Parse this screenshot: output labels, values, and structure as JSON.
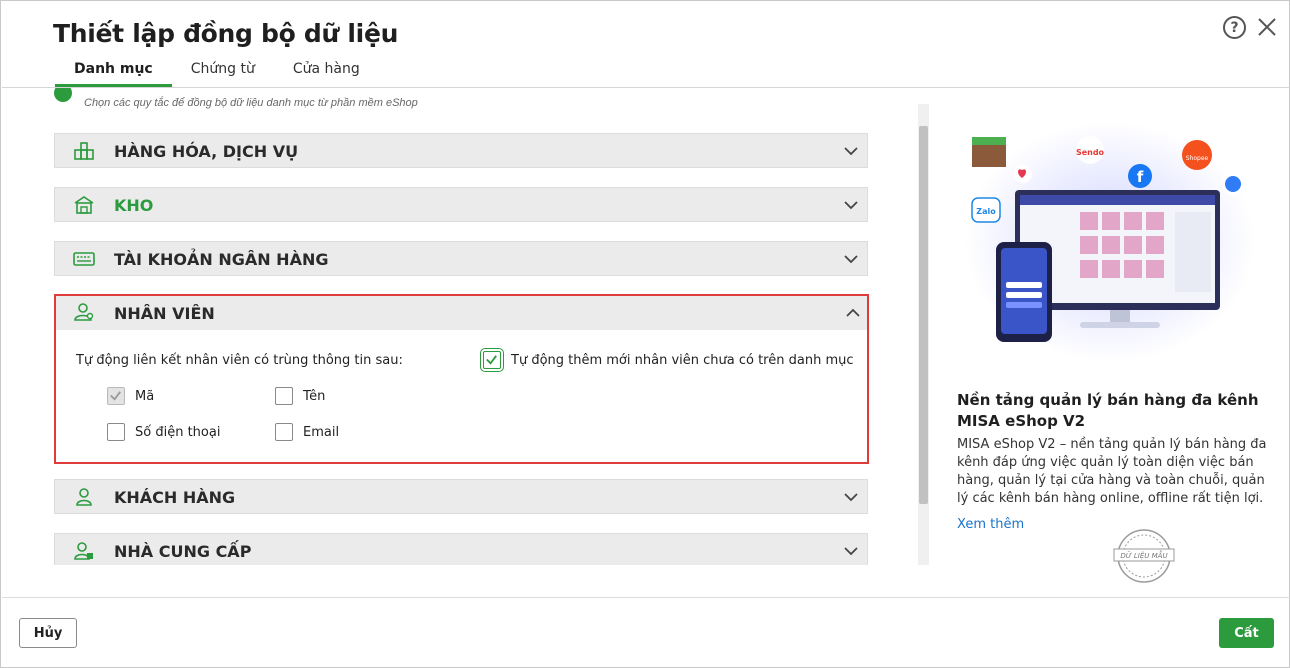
{
  "dialog": {
    "title": "Thiết lập đồng bộ dữ liệu",
    "help_label": "?"
  },
  "tabs": [
    {
      "label": "Danh mục",
      "active": true
    },
    {
      "label": "Chứng từ",
      "active": false
    },
    {
      "label": "Cửa hàng",
      "active": false
    }
  ],
  "hint": "Chọn các quy tắc để đồng bộ dữ liệu danh mục từ phần mềm eShop",
  "sections": {
    "goods": "HÀNG HÓA, DỊCH VỤ",
    "warehouse": "KHO",
    "bank": "TÀI KHOẢN NGÂN HÀNG",
    "employee": "NHÂN VIÊN",
    "customer": "KHÁCH HÀNG",
    "supplier": "NHÀ CUNG CẤP"
  },
  "employee_panel": {
    "auto_link_label": "Tự động liên kết nhân viên có trùng thông tin sau:",
    "auto_add_label": "Tự động thêm mới nhân viên chưa có trên danh mục",
    "auto_add_checked": true,
    "options": {
      "code": {
        "label": "Mã",
        "checked": true,
        "disabled": true
      },
      "name": {
        "label": "Tên",
        "checked": false
      },
      "phone": {
        "label": "Số điện thoại",
        "checked": false
      },
      "email": {
        "label": "Email",
        "checked": false
      }
    }
  },
  "promo": {
    "title": "Nền tảng quản lý bán hàng đa kênh MISA eShop V2",
    "description": "MISA eShop V2 – nền tảng quản lý bán hàng đa kênh đáp ứng việc quản lý toàn diện việc bán hàng, quản lý tại cửa hàng và toàn chuỗi, quản lý các kênh bán hàng online, offline rất tiện lợi.",
    "link": "Xem thêm",
    "stamp_text": "DỮ LIỆU MẪU",
    "logo_sendo": "Sendo",
    "logo_shopee": "Shopee",
    "logo_zalo": "Zalo",
    "logo_facebook": "f"
  },
  "footer": {
    "cancel_label": "Hủy",
    "save_label": "Cất"
  },
  "colors": {
    "accent": "#2b9b3e",
    "highlight_border": "#e03b3b",
    "link": "#1a73c9"
  }
}
